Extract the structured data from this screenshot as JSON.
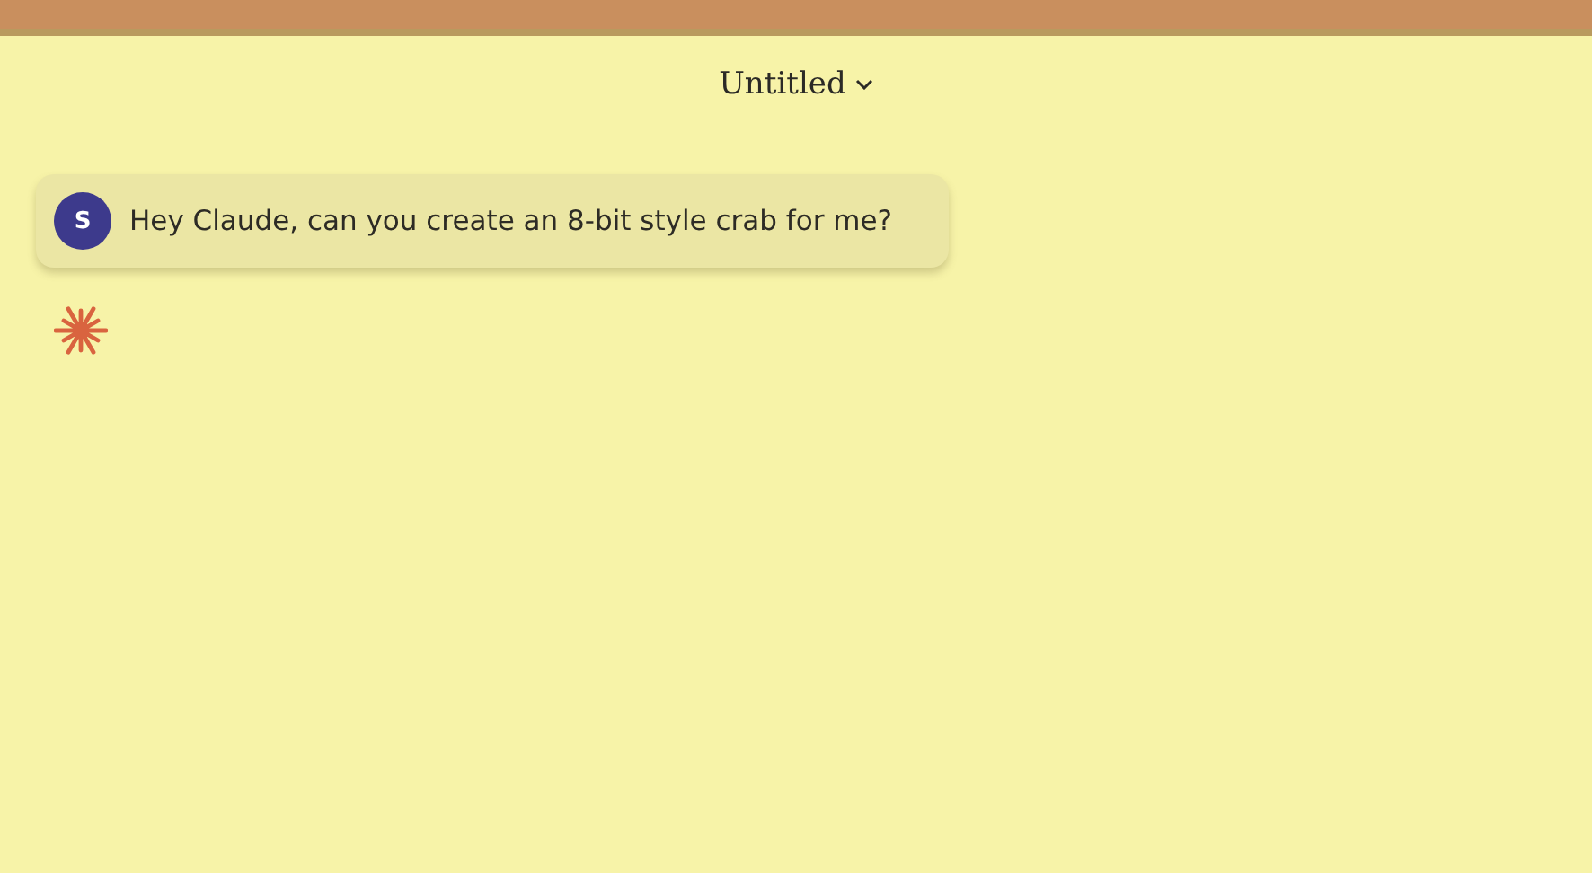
{
  "header": {
    "title": "Untitled"
  },
  "messages": [
    {
      "kind": "user",
      "avatar": "S",
      "text": "Hey Claude, can you create an 8-bit style crab for me?"
    },
    {
      "kind": "assistant"
    }
  ]
}
